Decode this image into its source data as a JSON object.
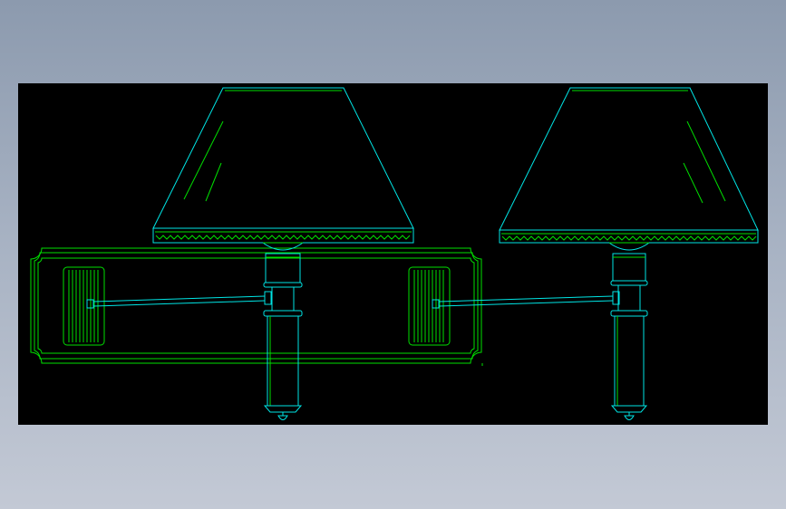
{
  "theme": {
    "background_top": "#8c9aae",
    "background_bottom": "#c3c9d5",
    "canvas": "#000000",
    "line_cyan": "#00e5e5",
    "line_green": "#00e000"
  },
  "drawing": {
    "name": "",
    "entities": [
      "wall-plate",
      "swing-arm-lamp-left",
      "swing-arm-lamp-right"
    ]
  }
}
